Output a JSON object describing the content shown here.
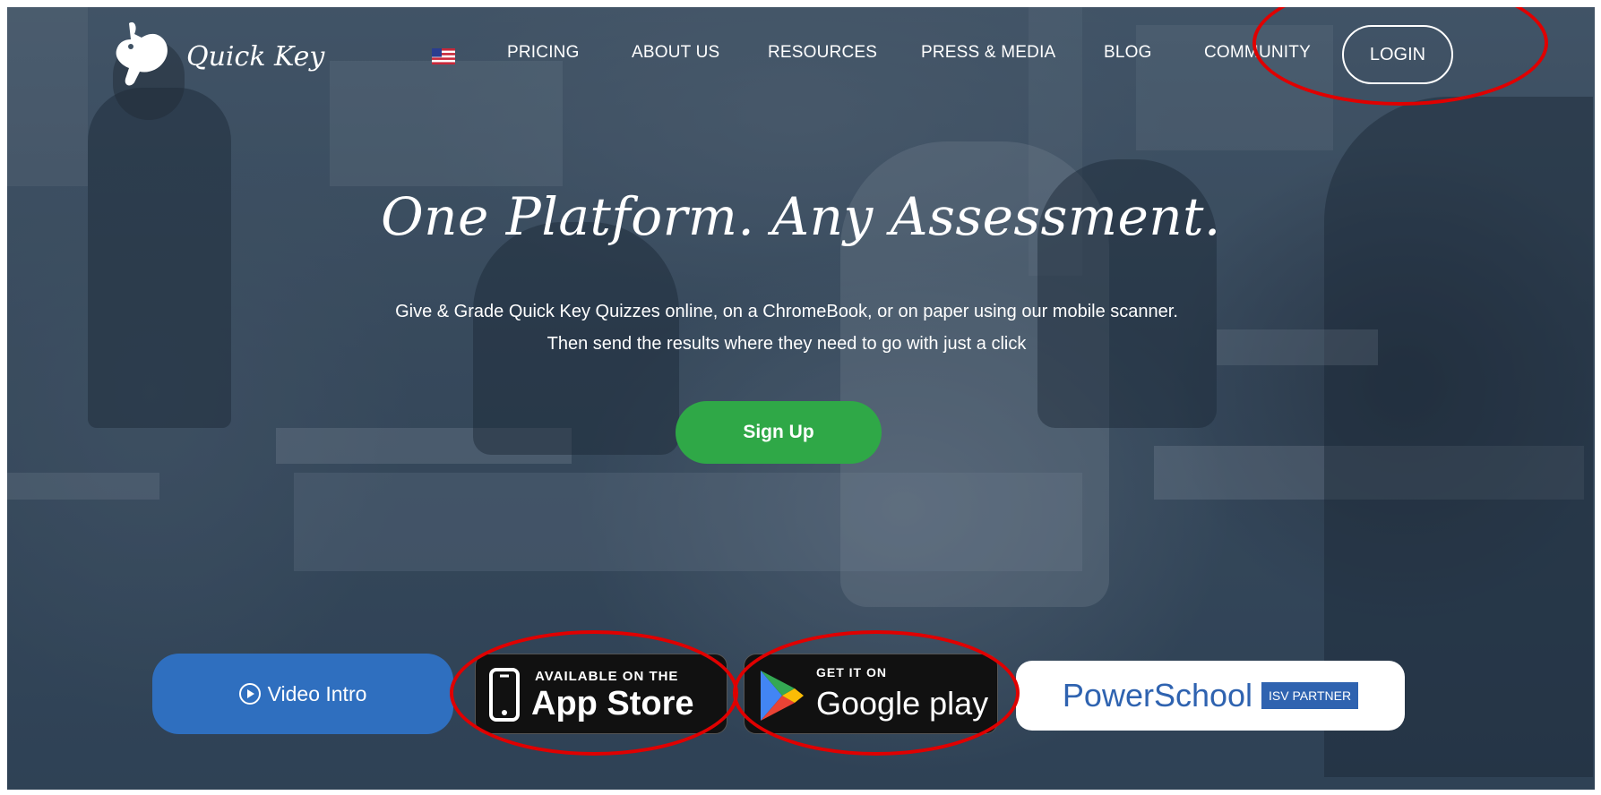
{
  "brand": {
    "name": "Quick Key",
    "logo_icon": "rabbit-icon"
  },
  "nav": {
    "language_flag": "us-flag-icon",
    "links": [
      "PRICING",
      "ABOUT US",
      "RESOURCES",
      "PRESS & MEDIA",
      "BLOG",
      "COMMUNITY"
    ],
    "login_label": "LOGIN"
  },
  "hero": {
    "title": "One Platform. Any Assessment.",
    "subtitle": "Give & Grade Quick Key Quizzes online, on a ChromeBook, or on paper using our mobile scanner. Then send the results where they need to go with just a click",
    "signup_label": "Sign Up"
  },
  "badges": {
    "video_intro_label": "Video Intro",
    "app_store": {
      "small": "AVAILABLE ON THE",
      "big": "App Store"
    },
    "google_play": {
      "small": "GET IT ON",
      "big": "Google play"
    },
    "powerschool": {
      "name": "PowerSchool",
      "tag": "ISV PARTNER"
    }
  },
  "colors": {
    "signup_green": "#2fa847",
    "video_blue": "#2f6fbf",
    "powerschool_blue": "#2f63b0",
    "annotation_red": "#e00000"
  }
}
